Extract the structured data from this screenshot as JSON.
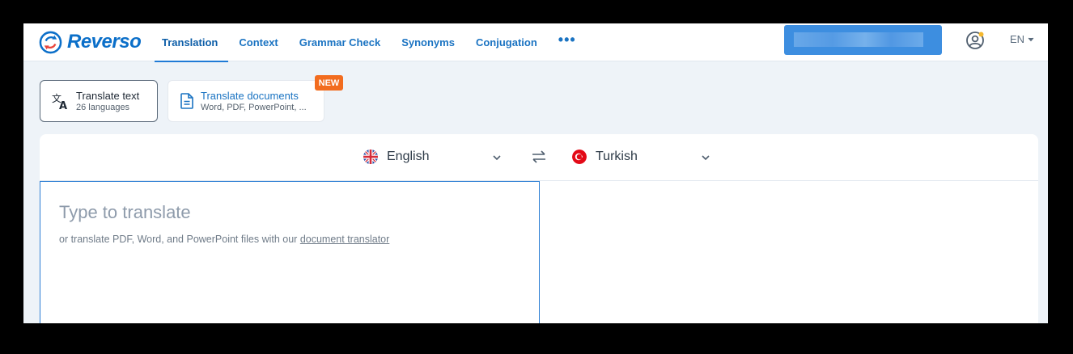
{
  "logo": {
    "text": "Reverso"
  },
  "nav": {
    "items": [
      {
        "label": "Translation",
        "active": true
      },
      {
        "label": "Context"
      },
      {
        "label": "Grammar Check"
      },
      {
        "label": "Synonyms"
      },
      {
        "label": "Conjugation"
      }
    ],
    "more": "•••"
  },
  "header": {
    "ui_language": "EN"
  },
  "modes": {
    "text": {
      "title": "Translate text",
      "subtitle": "26 languages"
    },
    "documents": {
      "title": "Translate documents",
      "subtitle": "Word, PDF, PowerPoint, ...",
      "badge": "NEW"
    }
  },
  "translator": {
    "source_language": "English",
    "target_language": "Turkish",
    "placeholder": "Type to translate",
    "hint_prefix": "or translate PDF, Word, and PowerPoint files with our ",
    "hint_link": "document translator"
  },
  "colors": {
    "brand": "#0b6fc9",
    "badge": "#f26c1f",
    "focus_border": "#2e7fd4"
  }
}
